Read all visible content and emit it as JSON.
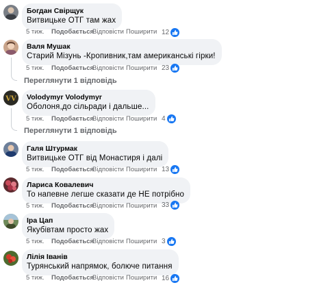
{
  "actions": {
    "time": "5 тиж.",
    "like": "Подобається",
    "reply": "Відповісти",
    "share": "Поширити"
  },
  "comments": [
    {
      "author": "Богдан Свірщук",
      "text": "Витвицьке ОТГ там жах",
      "reactions": "12"
    },
    {
      "author": "Валя Мушак",
      "text": "Старий Мізунь -Кропивник,там американські гірки!",
      "reactions": "23",
      "view_replies": "Переглянути 1 відповідь"
    },
    {
      "author": "Volodymyr Volodymyr",
      "text": "Оболоня,до сільради і дальше...",
      "reactions": "4",
      "view_replies": "Переглянути 1 відповідь"
    },
    {
      "author": "Галя Штурмак",
      "text": "Витвицьке ОТГ від Монастиря і далі",
      "reactions": "13"
    },
    {
      "author": "Лариса Ковалевич",
      "text": "То напевне легше сказати де НЕ потрібно",
      "reactions": "33"
    },
    {
      "author": "Іра Цап",
      "text": "Якубівтам просто жах",
      "reactions": "3"
    },
    {
      "author": "Лілія Іванів",
      "text": "Турянський напрямок, болюче питання",
      "reactions": "16"
    }
  ],
  "colors": {
    "bubble": "#f0f2f5",
    "meta": "#65676b",
    "like_badge": "#1877f2"
  },
  "icons": {
    "reaction": "thumbs-up-icon"
  }
}
